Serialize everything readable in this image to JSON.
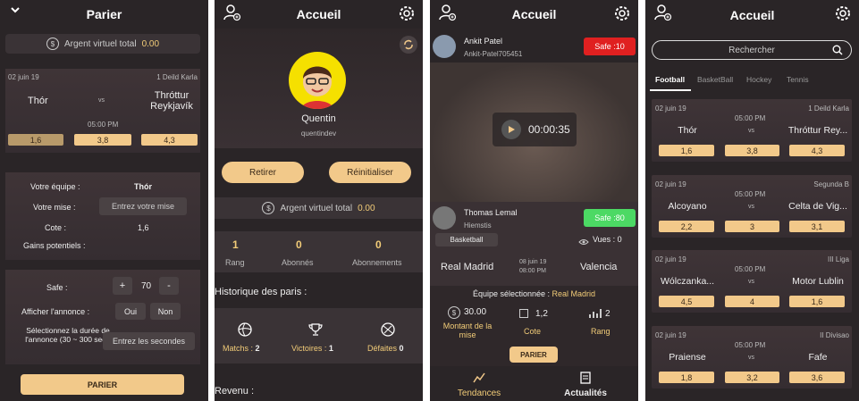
{
  "screen1": {
    "title": "Parier",
    "balance_label": "Argent virtuel total",
    "balance_value": "0.00",
    "match": {
      "date": "02 juin 19",
      "league": "1 Deild Karla",
      "home": "Thór",
      "vs": "vs",
      "away": "Thróttur Reykjavík",
      "time": "05:00 PM",
      "odds": [
        "1,6",
        "3,8",
        "4,3"
      ]
    },
    "team_label": "Votre équipe :",
    "team_value": "Thór",
    "stake_label": "Votre mise :",
    "stake_placeholder": "Entrez votre mise",
    "odds_label": "Cote :",
    "odds_value": "1,6",
    "gains_label": "Gains potentiels :",
    "safe_label": "Safe :",
    "safe_plus": "+",
    "safe_value": "70",
    "safe_minus": "-",
    "show_label": "Afficher l'annonce :",
    "yes": "Oui",
    "no": "Non",
    "duration_label": "Sélectionnez la durée de l'annonce (30 ~ 300 sec):",
    "duration_placeholder": "Entrez les secondes",
    "submit": "PARIER"
  },
  "screen2": {
    "title": "Accueil",
    "name": "Quentin",
    "username": "quentindev",
    "withdraw": "Retirer",
    "reset": "Réinitialiser",
    "balance_label": "Argent virtuel total",
    "balance_value": "0.00",
    "stats": [
      {
        "value": "1",
        "label": "Rang"
      },
      {
        "value": "0",
        "label": "Abonnés"
      },
      {
        "value": "0",
        "label": "Abonnements"
      }
    ],
    "history_title": "Historique des paris :",
    "history": [
      {
        "label": "Matchs :",
        "value": "2"
      },
      {
        "label": "Victoires :",
        "value": "1"
      },
      {
        "label": "Défaites",
        "value": "0"
      }
    ],
    "revenue_title": "Revenu :"
  },
  "screen3": {
    "title": "Accueil",
    "post1": {
      "name": "Ankit Patel",
      "handle": "Ankit-Patel705451",
      "badge": "Safe :10"
    },
    "video_time": "00:00:35",
    "post2": {
      "name": "Thomas Lemal",
      "handle": "Hiemstis",
      "badge": "Safe :80"
    },
    "sport_tag": "Basketball",
    "views": "Vues : 0",
    "match": {
      "home": "Real Madrid",
      "date": "08 juin 19",
      "time": "08:00 PM",
      "away": "Valencia"
    },
    "selected_label": "Équipe sélectionnée :",
    "selected_team": "Real Madrid",
    "amount": "30.00",
    "amount_label": "Montant de la mise",
    "cote_value": "1,2",
    "cote_label": "Cote",
    "rang_value": "2",
    "rang_label": "Rang",
    "bet_button": "PARIER",
    "tabs": [
      "Tendances",
      "Actualités"
    ]
  },
  "screen4": {
    "title": "Accueil",
    "search_placeholder": "Rechercher",
    "tabs": [
      "Football",
      "BasketBall",
      "Hockey",
      "Tennis"
    ],
    "matches": [
      {
        "date": "02 juin 19",
        "league": "1 Deild Karla",
        "time": "05:00 PM",
        "home": "Thór",
        "away": "Thróttur Rey...",
        "odds": [
          "1,6",
          "3,8",
          "4,3"
        ]
      },
      {
        "date": "02 juin 19",
        "league": "Segunda B",
        "time": "05:00 PM",
        "home": "Alcoyano",
        "away": "Celta de Vig...",
        "odds": [
          "2,2",
          "3",
          "3,1"
        ]
      },
      {
        "date": "02 juin 19",
        "league": "III Liga",
        "time": "05:00 PM",
        "home": "Wólczanka...",
        "away": "Motor Lublin",
        "odds": [
          "4,5",
          "4",
          "1,6"
        ]
      },
      {
        "date": "02 juin 19",
        "league": "II Divisao",
        "time": "05:00 PM",
        "home": "Praiense",
        "away": "Fafe",
        "odds": [
          "1,8",
          "3,2",
          "3,6"
        ]
      }
    ],
    "vs": "vs"
  },
  "colors": {
    "accent": "#f2c98a",
    "gold_text": "#f2cc78",
    "bg": "#2a2527",
    "safe_red": "#e02020",
    "safe_green": "#4cd964"
  }
}
